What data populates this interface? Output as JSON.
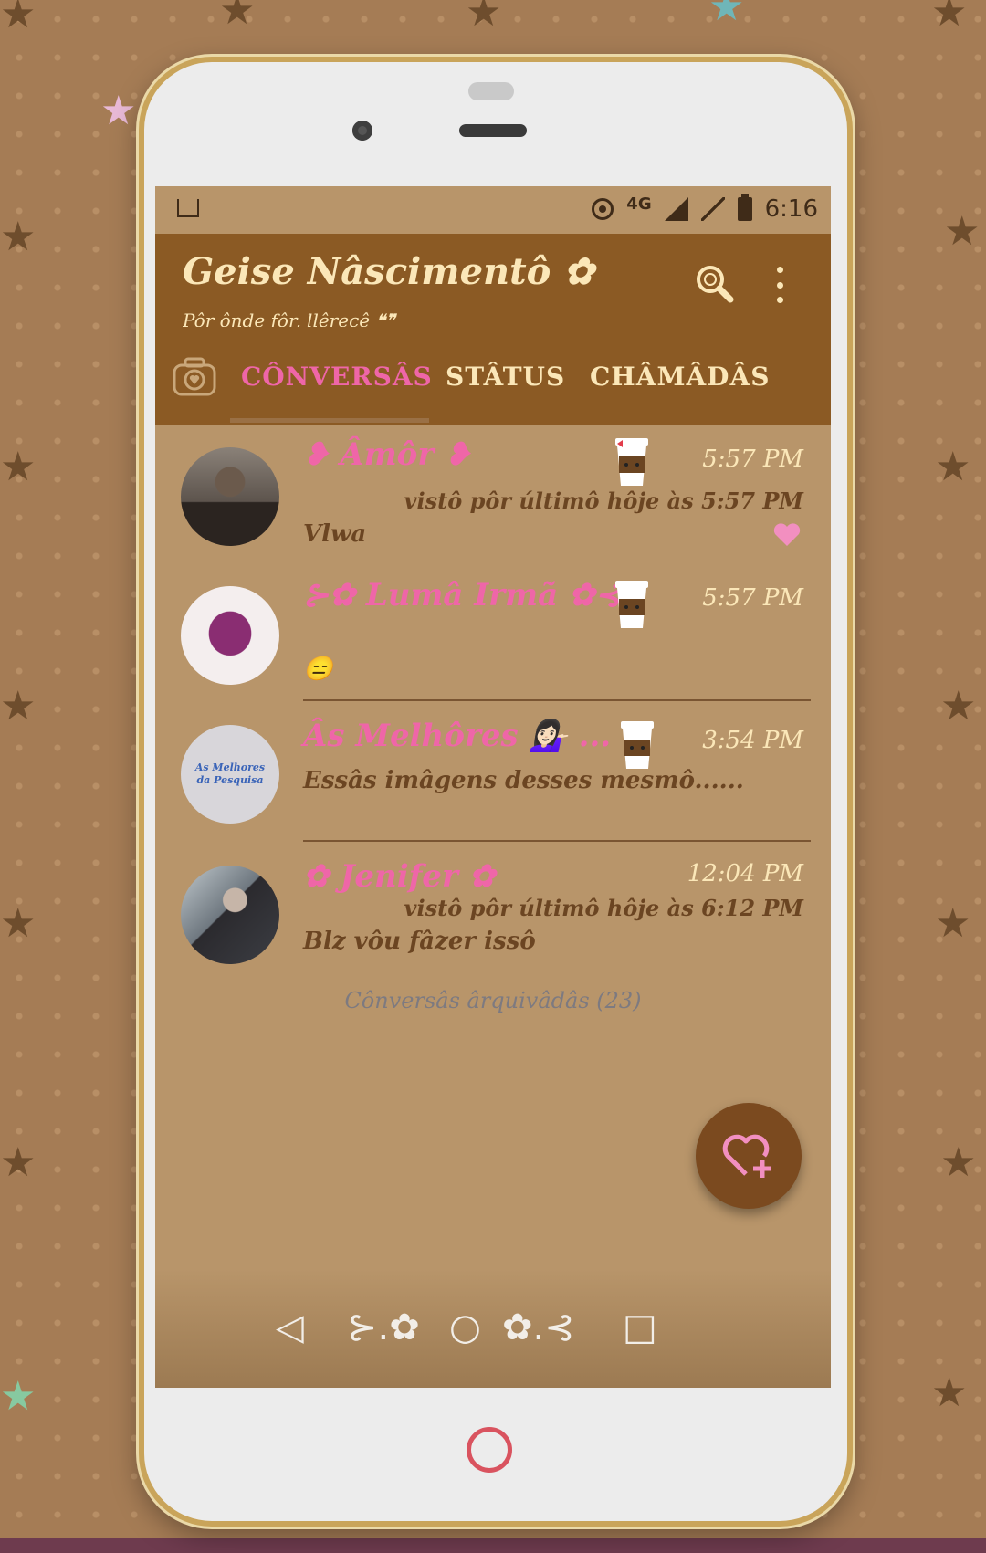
{
  "status_bar": {
    "network": "4G",
    "time": "6:16",
    "icons": [
      "image-notification-icon",
      "hotspot-icon",
      "signal-icon",
      "signal-empty-icon",
      "battery-icon"
    ]
  },
  "app_bar": {
    "title": "Geise Nâscimentô ✿",
    "subtitle": "Pôr ônde fôr, llêreçê ❝❞",
    "icons": [
      "search-icon",
      "more-vert-icon"
    ]
  },
  "tabs": [
    {
      "label": "CÔNVERSÂS",
      "active": true
    },
    {
      "label": "STÂTUS",
      "active": false
    },
    {
      "label": "CHÂMÂDÂS",
      "active": false
    }
  ],
  "chats": [
    {
      "name": "❥ Âmôr ❥",
      "time": "5:57 PM",
      "last_seen": "vistô pôr últimô hôje às 5:57 PM",
      "message": "Vlwa",
      "badge": "heart-icon",
      "avatar_colors": [
        "#7d7469",
        "#2b2420"
      ]
    },
    {
      "name": "⊱✿ Lumâ Irmã ✿⊰",
      "time": "5:57 PM",
      "message": "😑",
      "avatar_colors": [
        "#f4eeee",
        "#7a1f63"
      ]
    },
    {
      "name": "Âs Melhôres 💁🏻‍♀️ ...",
      "time": "3:54 PM",
      "message": "Essâs imâgens desses mesmô......",
      "avatar_text": "As Melhores da Pesquisa",
      "avatar_colors": [
        "#d8d6da",
        "#3a64b8"
      ]
    },
    {
      "name": "✿ Jenifer ✿",
      "time": "12:04 PM",
      "last_seen": "vistô pôr últimô hôje às 6:12 PM",
      "message": "Blz vôu fâzer issô",
      "avatar_colors": [
        "#9aa3a8",
        "#2b2a2e"
      ]
    }
  ],
  "archived_label": "Cônversâs ârquivâdâs (23)",
  "fab_icon": "heart-add-icon",
  "nav": {
    "items": [
      "◁",
      "⊱.✿",
      "○",
      "✿.⊰",
      "□"
    ]
  },
  "colors": {
    "app_bar": "#8b5a24",
    "screen_bg": "#b8956a",
    "accent_pink": "#ef66a8",
    "cream": "#fbe7b8",
    "brown_text": "#6b4522",
    "fab": "#7b4a1f"
  }
}
